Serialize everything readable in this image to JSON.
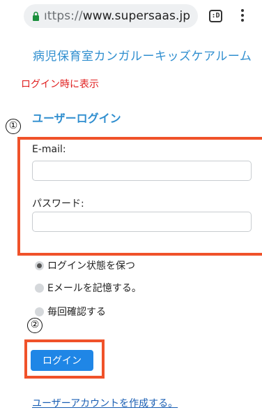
{
  "browser": {
    "url_scheme": "ıttps://",
    "url_host": "www.supersaas.jp",
    "tabs_count": ":D"
  },
  "page": {
    "site_title": "病児保育室カンガルーキッズケアルーム",
    "red_note": "ログイン時に表示",
    "section_title": "ユーザーログイン",
    "marker_1": "①",
    "marker_2": "②",
    "email_label": "E-mail:",
    "email_value": "",
    "password_label": "パスワード:",
    "password_value": "",
    "options": [
      {
        "label": "ログイン状態を保つ",
        "checked": true
      },
      {
        "label": "Eメールを記憶する。",
        "checked": false
      },
      {
        "label": "毎回確認する",
        "checked": false
      }
    ],
    "login_button": "ログイン",
    "signup_link": "ユーザーアカウントを作成する。"
  },
  "colors": {
    "accent_blue": "#2f8ecf",
    "button_blue": "#1f86e6",
    "highlight_orange": "#f0522a",
    "note_red": "#e02020"
  }
}
